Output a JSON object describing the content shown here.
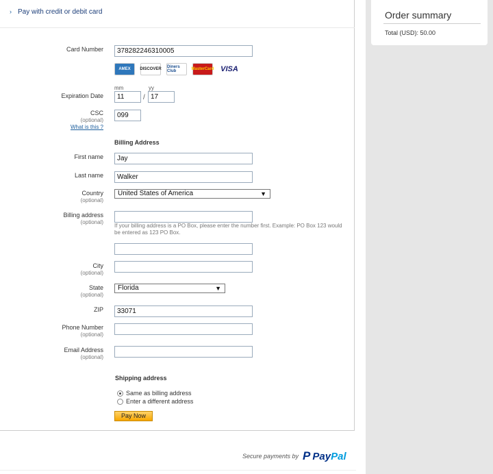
{
  "header": {
    "chevron_icon": "chevron-right",
    "title": "Pay with credit or debit card"
  },
  "order_summary": {
    "title": "Order summary",
    "total_label": "Total (USD): 50.00"
  },
  "card_number": {
    "label": "Card Number",
    "value": "378282246310005"
  },
  "card_brands": [
    "AMEX",
    "DISCOVER",
    "Diners Club",
    "MasterCard",
    "VISA"
  ],
  "expiration": {
    "label": "Expiration Date",
    "mm_label": "mm",
    "yy_label": "yy",
    "month": "11",
    "year": "17",
    "separator": "/"
  },
  "csc": {
    "label": "CSC",
    "optional": "(optional)",
    "help_link": "What is this ?",
    "value": "099"
  },
  "billing": {
    "section_title": "Billing Address",
    "first_name": {
      "label": "First name",
      "value": "Jay"
    },
    "last_name": {
      "label": "Last name",
      "value": "Walker"
    },
    "country": {
      "label": "Country",
      "optional": "(optional)",
      "value": "United States of America"
    },
    "address": {
      "label": "Billing address",
      "optional": "(optional)",
      "value": "",
      "hint": "If your billing address is a PO Box, please enter the number first. Example: PO Box 123 would be entered as 123 PO Box.",
      "line2": ""
    },
    "city": {
      "label": "City",
      "optional": "(optional)",
      "value": ""
    },
    "state": {
      "label": "State",
      "optional": "(optional)",
      "value": "Florida"
    },
    "zip": {
      "label": "ZIP",
      "value": "33071"
    },
    "phone": {
      "label": "Phone Number",
      "optional": "(optional)",
      "value": ""
    },
    "email": {
      "label": "Email Address",
      "optional": "(optional)",
      "value": ""
    }
  },
  "shipping": {
    "section_title": "Shipping address",
    "options": [
      {
        "label": "Same as billing address",
        "selected": true
      },
      {
        "label": "Enter a different address",
        "selected": false
      }
    ]
  },
  "pay_button": "Pay Now",
  "footer": {
    "secure_text": "Secure payments by",
    "brand_pay": "Pay",
    "brand_pal": "Pal"
  }
}
